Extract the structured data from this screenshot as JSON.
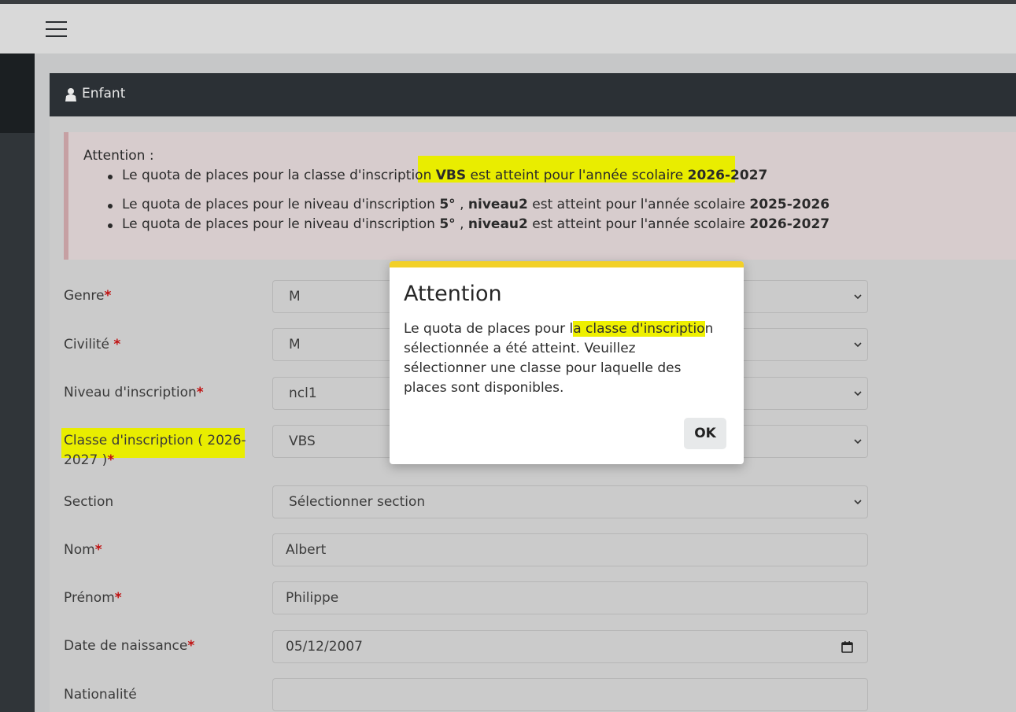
{
  "navbar": {
    "menu_icon": "hamburger-menu-icon"
  },
  "card": {
    "title": "Enfant",
    "icon": "user-icon"
  },
  "alert": {
    "heading": "Attention :",
    "items": [
      {
        "pre": "Le quota de places pour la classe d'inscription ",
        "b1": "VBS",
        "mid": " est atteint pour l'année scolaire ",
        "b2": "2026-2027"
      },
      {
        "pre": "Le quota de places pour le niveau d'inscription ",
        "b1": "5°",
        "sep": " , ",
        "b1b": "niveau2",
        "mid": " est atteint pour l'année scolaire ",
        "b2": "2025-2026"
      },
      {
        "pre": "Le quota de places pour le niveau d'inscription ",
        "b1": "5°",
        "sep": " , ",
        "b1b": "niveau2",
        "mid": " est atteint pour l'année scolaire ",
        "b2": "2026-2027"
      }
    ]
  },
  "form": {
    "genre": {
      "label": "Genre",
      "value": "M"
    },
    "civilite": {
      "label": "Civilité ",
      "value": "M"
    },
    "niveau": {
      "label": "Niveau d'inscription",
      "value": "ncl1"
    },
    "classe": {
      "label_line1": "Classe d'inscription ( 2026-",
      "label_line2": "2027 )",
      "value": "VBS"
    },
    "section": {
      "label": "Section",
      "value": "Sélectionner section"
    },
    "nom": {
      "label": "Nom",
      "value": "Albert"
    },
    "prenom": {
      "label": "Prénom",
      "value": "Philippe"
    },
    "naissance": {
      "label": "Date de naissance",
      "value": "05/12/2007"
    },
    "nationalite": {
      "label": "Nationalité",
      "value": ""
    }
  },
  "required_mark": "*",
  "modal": {
    "title": "Attention",
    "body_pre": "Le quota de places pour l",
    "body_hl": "a classe d'inscriptio",
    "body_post": "n sélectionnée a été atteint. Veuillez sélectionner une classe pour laquelle des places sont disponibles.",
    "ok_label": "OK"
  },
  "colors": {
    "highlight": "#eef000",
    "modal_accent": "#f2d027",
    "required": "#c01010"
  }
}
